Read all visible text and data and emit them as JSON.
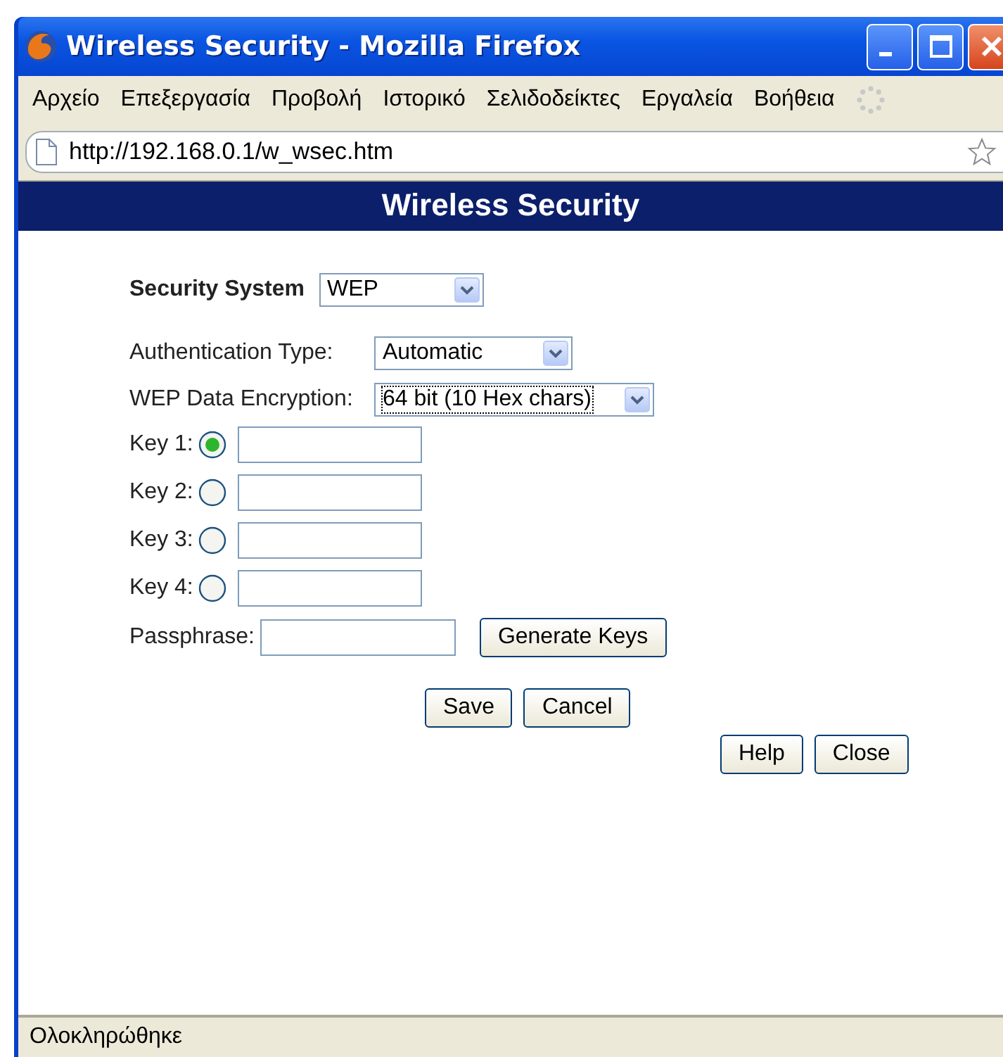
{
  "window": {
    "title": "Wireless Security - Mozilla Firefox"
  },
  "menu": [
    "Αρχείο",
    "Επεξεργασία",
    "Προβολή",
    "Ιστορικό",
    "Σελιδοδείκτες",
    "Εργαλεία",
    "Βοήθεια"
  ],
  "address_bar": {
    "value": "http://192.168.0.1/w_wsec.htm"
  },
  "page_header": "Wireless Security",
  "security_system": {
    "label": "Security System",
    "value": "WEP"
  },
  "authentication_type": {
    "label": "Authentication Type:",
    "value": "Automatic"
  },
  "wep_encryption": {
    "label": "WEP Data Encryption:",
    "value": "64 bit (10 Hex chars)"
  },
  "keys": [
    {
      "label": "Key 1:",
      "selected": true
    },
    {
      "label": "Key 2:",
      "selected": false
    },
    {
      "label": "Key 3:",
      "selected": false
    },
    {
      "label": "Key 4:",
      "selected": false
    }
  ],
  "passphrase": {
    "label": "Passphrase:"
  },
  "generate_button": "Generate Keys",
  "form_buttons": [
    "Save",
    "Cancel"
  ],
  "dialog_buttons": [
    "Help",
    "Close"
  ],
  "status_bar": "Ολοκληρώθηκε"
}
